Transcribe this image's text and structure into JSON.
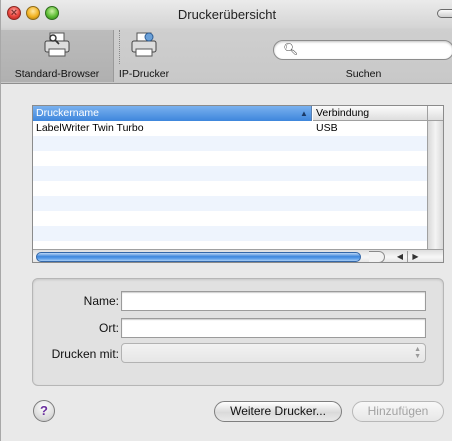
{
  "window": {
    "title": "Druckerübersicht"
  },
  "toolbar": {
    "items": [
      {
        "label": "Standard-Browser",
        "icon": "printer-search-icon",
        "selected": true
      },
      {
        "label": "IP-Drucker",
        "icon": "network-printer-icon",
        "selected": false
      }
    ],
    "search": {
      "label": "Suchen",
      "value": "",
      "placeholder": ""
    }
  },
  "printer_list": {
    "columns": [
      "Druckername",
      "Verbindung"
    ],
    "sort_column": "Druckername",
    "sort_direction": "ascending",
    "rows": [
      {
        "name": "LabelWriter Twin Turbo",
        "connection": "USB"
      }
    ]
  },
  "details": {
    "name_label": "Name:",
    "name_value": "",
    "location_label": "Ort:",
    "location_value": "",
    "print_with_label": "Drucken mit:",
    "print_with_value": ""
  },
  "buttons": {
    "help": "?",
    "more_printers": "Weitere Drucker...",
    "add": "Hinzufügen"
  },
  "colors": {
    "selection_blue": "#3e86dc",
    "alt_row": "#eef4fd",
    "help_glyph": "#6b2f9f"
  }
}
